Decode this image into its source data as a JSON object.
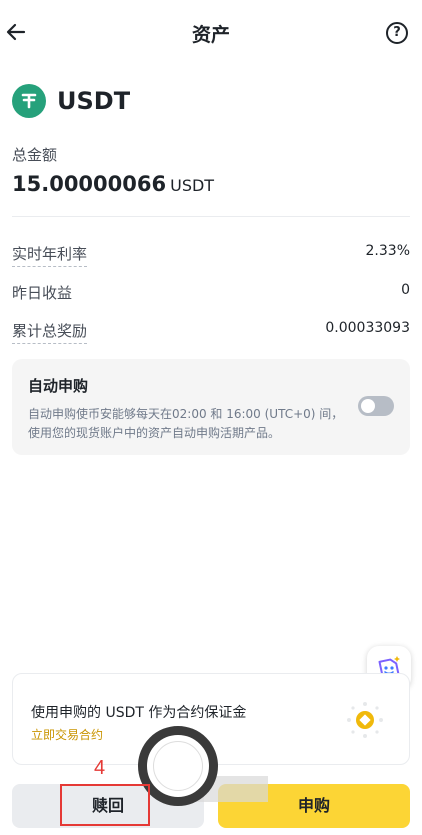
{
  "header": {
    "title": "资产",
    "help_glyph": "?"
  },
  "asset": {
    "name": "USDT",
    "icon": "tether-icon",
    "brand_color": "#26a17b"
  },
  "total": {
    "label": "总金额",
    "value": "15.00000066",
    "unit": "USDT"
  },
  "stats": [
    {
      "label": "实时年利率",
      "value": "2.33%"
    },
    {
      "label": "昨日收益",
      "value": "0"
    },
    {
      "label": "累计总奖励",
      "value": "0.00033093"
    }
  ],
  "auto_subscribe": {
    "title": "自动申购",
    "description": "自动申购使币安能够每天在02:00 和 16:00 (UTC+0) 间，使用您的现货账户中的资产自动申购活期产品。",
    "enabled": false
  },
  "promo": {
    "text": "使用申购的 USDT 作为合约保证金",
    "link": "立即交易合约"
  },
  "actions": {
    "redeem": "赎回",
    "subscribe": "申购"
  },
  "annotation": {
    "number": "4"
  },
  "colors": {
    "accent": "#fcd535",
    "link": "#c99400",
    "annotation": "#e53935"
  }
}
